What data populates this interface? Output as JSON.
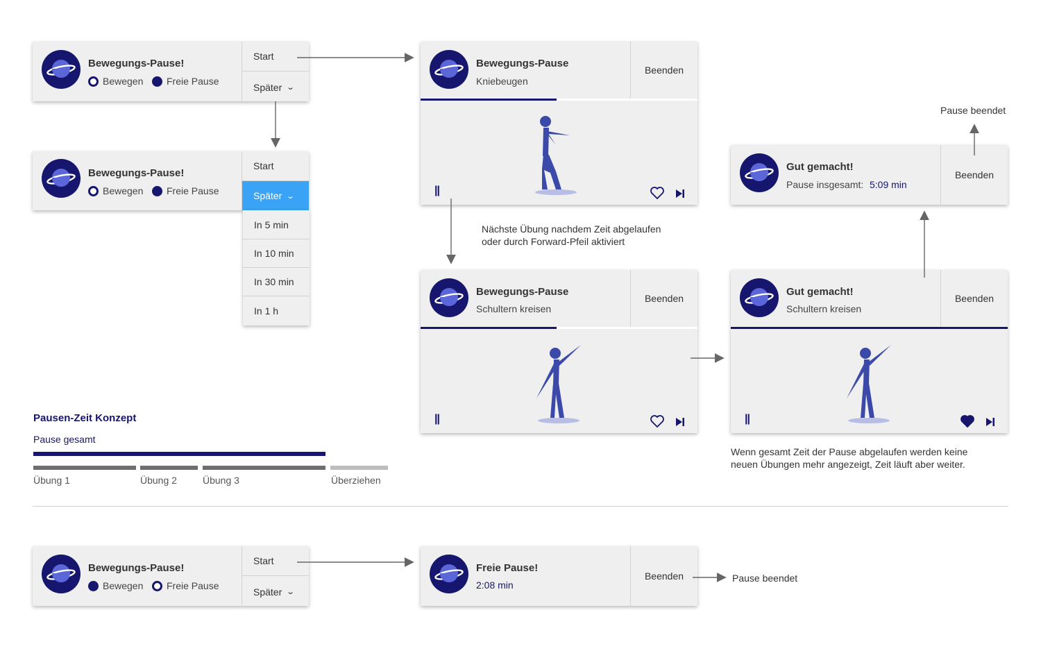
{
  "brand_color": "#16166e",
  "accent_color": "#3aa3f5",
  "icons": {
    "logo": "planet-logo-icon",
    "pause": "pause-icon",
    "heart": "heart-icon",
    "skip": "skip-forward-icon",
    "chevron": "chevron-down-icon"
  },
  "notif1": {
    "title": "Bewegungs-Pause!",
    "opt1": "Bewegen",
    "opt2": "Freie Pause",
    "start": "Start",
    "later": "Später"
  },
  "notif2": {
    "title": "Bewegungs-Pause!",
    "opt1": "Bewegen",
    "opt2": "Freie Pause",
    "start": "Start",
    "later": "Später"
  },
  "later_menu": {
    "items": [
      "In 5 min",
      "In 10 min",
      "In 30 min",
      "In 1 h"
    ]
  },
  "ex1": {
    "title": "Bewegungs-Pause",
    "exercise": "Kniebeugen",
    "end": "Beenden",
    "progress": 0.49
  },
  "ex2": {
    "title": "Bewegungs-Pause",
    "exercise": "Schultern kreisen",
    "end": "Beenden",
    "progress": 0.49
  },
  "done1": {
    "title": "Gut gemacht!",
    "exercise": "Schultern kreisen",
    "end": "Beenden",
    "progress": 1.0,
    "liked": true
  },
  "done2": {
    "title": "Gut gemacht!",
    "total_label": "Pause insgesamt:",
    "total_value": "5:09 min",
    "end": "Beenden"
  },
  "note_next": {
    "line1": "Nächste Übung nachdem Zeit abgelaufen",
    "line2": "oder durch Forward-Pfeil aktiviert"
  },
  "note_end": {
    "line1": "Wenn gesamt Zeit der Pause abgelaufen werden keine",
    "line2": "neuen Übungen mehr angezeigt, Zeit läuft aber weiter."
  },
  "pause_ended_top": "Pause beendet",
  "concept": {
    "title": "Pausen-Zeit Konzept",
    "total_label": "Pause gesamt",
    "segments": [
      "Übung 1",
      "Übung 2",
      "Übung 3",
      "Überziehen"
    ]
  },
  "notif3": {
    "title": "Bewegungs-Pause!",
    "opt1": "Bewegen",
    "opt2": "Freie Pause",
    "start": "Start",
    "later": "Später"
  },
  "free": {
    "title": "Freie Pause!",
    "time": "2:08 min",
    "end": "Beenden"
  },
  "pause_ended_bottom": "Pause beendet"
}
